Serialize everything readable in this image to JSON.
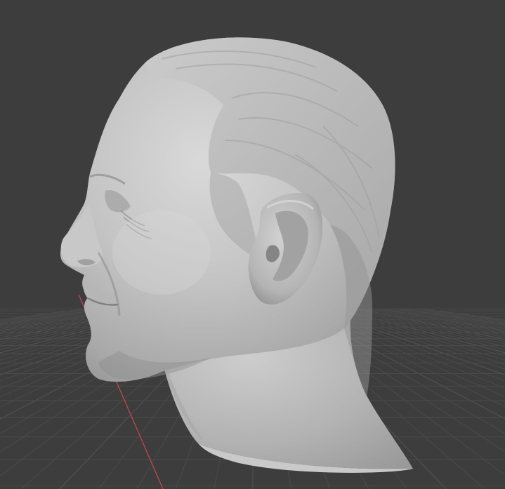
{
  "viewport": {
    "mode": "3d-viewport",
    "background_color": "#3d3d3d",
    "grid_line_color": "#4a4a4a",
    "grid_major_color": "#535353",
    "x_axis_color": "#c4464f",
    "model_color": "#b9b9b9",
    "model_name": "sculpted-head-bust",
    "shading": "matcap-clay"
  }
}
